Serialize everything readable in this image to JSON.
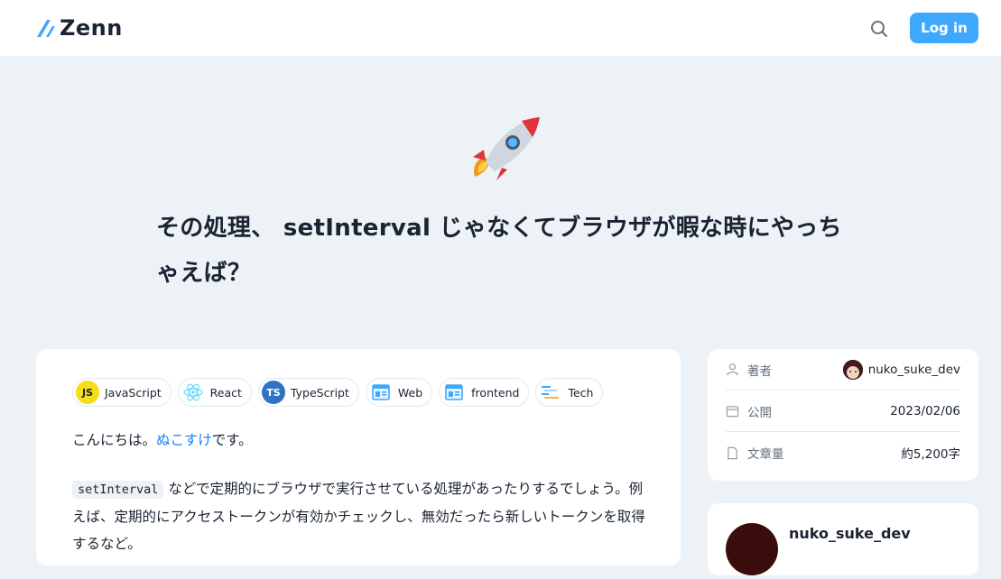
{
  "header": {
    "logo_text": "Zenn",
    "login_label": "Log in"
  },
  "article": {
    "title": "その処理、 setInterval じゃなくてブラウザが暇な時にやっちゃえば？",
    "topics": [
      {
        "label": "JavaScript",
        "icon": "javascript-icon"
      },
      {
        "label": "React",
        "icon": "react-icon"
      },
      {
        "label": "TypeScript",
        "icon": "typescript-icon"
      },
      {
        "label": "Web",
        "icon": "web-icon"
      },
      {
        "label": "frontend",
        "icon": "frontend-icon"
      },
      {
        "label": "Tech",
        "icon": "tech-icon"
      }
    ],
    "intro_prefix": "こんにちは。",
    "intro_link": "ぬこすけ",
    "intro_suffix": "です。",
    "code_term": "setInterval",
    "para2": " などで定期的にブラウザで実行させている処理があったりするでしょう。例えば、定期的にアクセストークンが有効かチェックし、無効だったら新しいトークンを取得するなど。"
  },
  "info": {
    "author_label": "著者",
    "author_name": "nuko_suke_dev",
    "published_label": "公開",
    "published_date": "2023/02/06",
    "length_label": "文章量",
    "length_value": "約5,200字"
  },
  "author_card": {
    "name": "nuko_suke_dev"
  },
  "colors": {
    "accent": "#3ea8ff",
    "link": "#0f83fd",
    "background": "#edf2f7"
  }
}
